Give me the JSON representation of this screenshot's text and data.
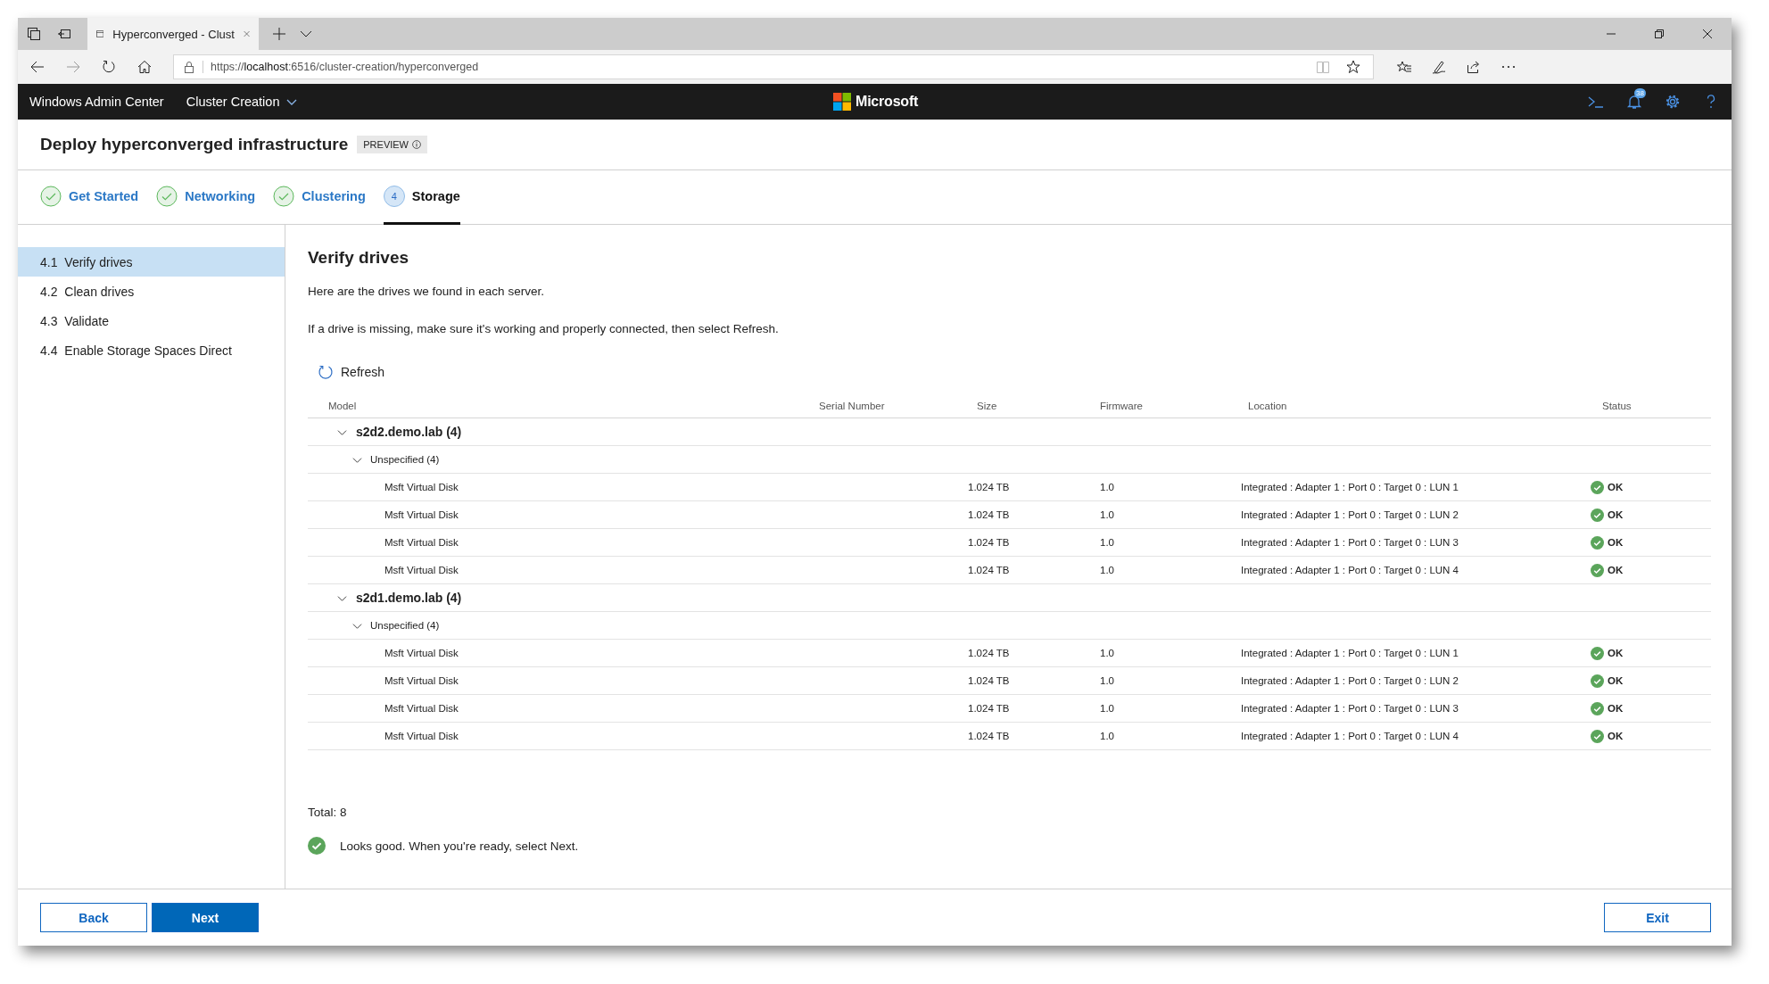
{
  "browser": {
    "tab_title": "Hyperconverged - Clust",
    "address": {
      "scheme": "https://",
      "host": "localhost",
      "path": ":6516/cluster-creation/hyperconverged"
    }
  },
  "app_bar": {
    "app_name": "Windows Admin Center",
    "context": "Cluster Creation",
    "brand": "Microsoft",
    "notification_count": "38"
  },
  "page": {
    "title": "Deploy hyperconverged infrastructure",
    "badge": "PREVIEW"
  },
  "steps": [
    {
      "label": "Get Started",
      "completed": true,
      "selected": false
    },
    {
      "label": "Networking",
      "completed": true,
      "selected": false
    },
    {
      "label": "Clustering",
      "completed": true,
      "selected": false
    },
    {
      "label": "Storage",
      "completed": false,
      "number": "4",
      "selected": true
    }
  ],
  "sidebar": {
    "items": [
      {
        "number": "4.1",
        "label": "Verify drives",
        "selected": true
      },
      {
        "number": "4.2",
        "label": "Clean drives",
        "selected": false
      },
      {
        "number": "4.3",
        "label": "Validate",
        "selected": false
      },
      {
        "number": "4.4",
        "label": "Enable Storage Spaces Direct",
        "selected": false
      }
    ]
  },
  "content": {
    "title": "Verify drives",
    "intro": "Here are the drives we found in each server.",
    "hint": "If a drive is missing, make sure it's working and properly connected, then select Refresh.",
    "refresh": "Refresh"
  },
  "table": {
    "columns": [
      "Model",
      "Serial Number",
      "Size",
      "Firmware",
      "Location",
      "Status"
    ],
    "rows": [
      {
        "name": "s2d2.demo.lab (4)",
        "expanded": true,
        "children": [
          {
            "name": "Unspecified (4)",
            "expanded": true,
            "children": [
              {
                "model": "Msft Virtual Disk",
                "size": "1.024 TB",
                "firmware": "1.0",
                "location": "Integrated : Adapter 1 : Port 0 : Target 0 : LUN 1",
                "status": "OK",
                "healthy": true
              },
              {
                "model": "Msft Virtual Disk",
                "size": "1.024 TB",
                "firmware": "1.0",
                "location": "Integrated : Adapter 1 : Port 0 : Target 0 : LUN 2",
                "status": "OK",
                "healthy": true
              },
              {
                "model": "Msft Virtual Disk",
                "size": "1.024 TB",
                "firmware": "1.0",
                "location": "Integrated : Adapter 1 : Port 0 : Target 0 : LUN 3",
                "status": "OK",
                "healthy": true
              },
              {
                "model": "Msft Virtual Disk",
                "size": "1.024 TB",
                "firmware": "1.0",
                "location": "Integrated : Adapter 1 : Port 0 : Target 0 : LUN 4",
                "status": "OK",
                "healthy": true
              }
            ]
          }
        ]
      },
      {
        "name": "s2d1.demo.lab (4)",
        "expanded": true,
        "children": [
          {
            "name": "Unspecified (4)",
            "expanded": true,
            "children": [
              {
                "model": "Msft Virtual Disk",
                "size": "1.024 TB",
                "firmware": "1.0",
                "location": "Integrated : Adapter 1 : Port 0 : Target 0 : LUN 1",
                "status": "OK",
                "healthy": true
              },
              {
                "model": "Msft Virtual Disk",
                "size": "1.024 TB",
                "firmware": "1.0",
                "location": "Integrated : Adapter 1 : Port 0 : Target 0 : LUN 2",
                "status": "OK",
                "healthy": true
              },
              {
                "model": "Msft Virtual Disk",
                "size": "1.024 TB",
                "firmware": "1.0",
                "location": "Integrated : Adapter 1 : Port 0 : Target 0 : LUN 3",
                "status": "OK",
                "healthy": true
              },
              {
                "model": "Msft Virtual Disk",
                "size": "1.024 TB",
                "firmware": "1.0",
                "location": "Integrated : Adapter 1 : Port 0 : Target 0 : LUN 4",
                "status": "OK",
                "healthy": true
              }
            ]
          }
        ]
      }
    ]
  },
  "total": "Total: 8",
  "result": {
    "text": "Looks good. When you're ready, select Next.",
    "ok": true
  },
  "footer": {
    "back": "Back",
    "next": "Next",
    "exit": "Exit"
  }
}
